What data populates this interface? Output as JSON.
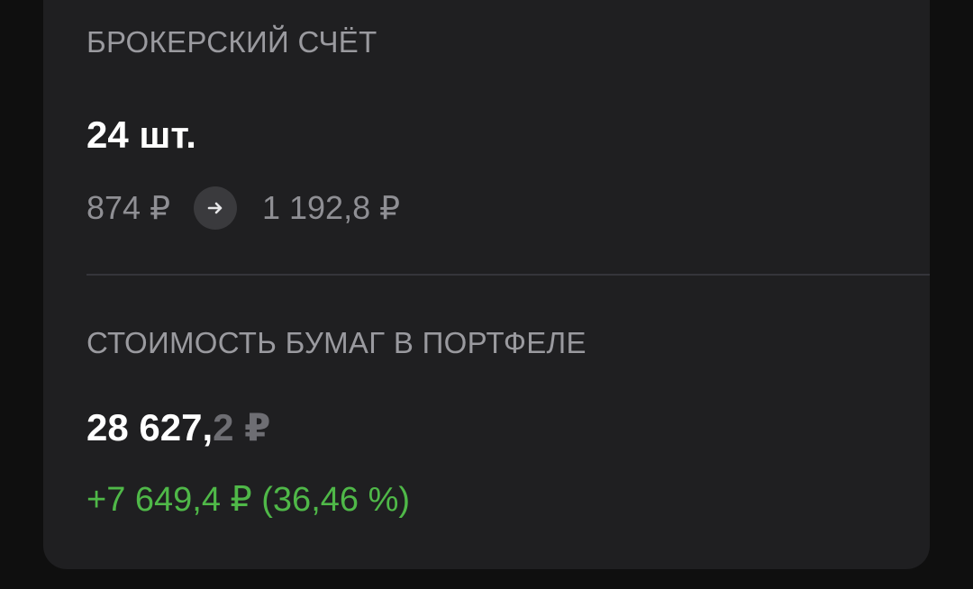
{
  "account": {
    "title": "БРОКЕРСКИЙ СЧЁТ",
    "quantity": "24 шт.",
    "price_from": "874 ₽",
    "price_to": "1 192,8 ₽",
    "arrow_icon": "arrow-right-icon"
  },
  "portfolio": {
    "title": "СТОИМОСТЬ БУМАГ В ПОРТФЕЛЕ",
    "value_main": "28 627,",
    "value_fraction": "2 ₽",
    "change": "+7 649,4 ₽ (36,46 %)"
  },
  "colors": {
    "background": "#0f0f0f",
    "card": "#1f1f21",
    "positive": "#4fb848",
    "muted_text": "#9a9a9f"
  }
}
